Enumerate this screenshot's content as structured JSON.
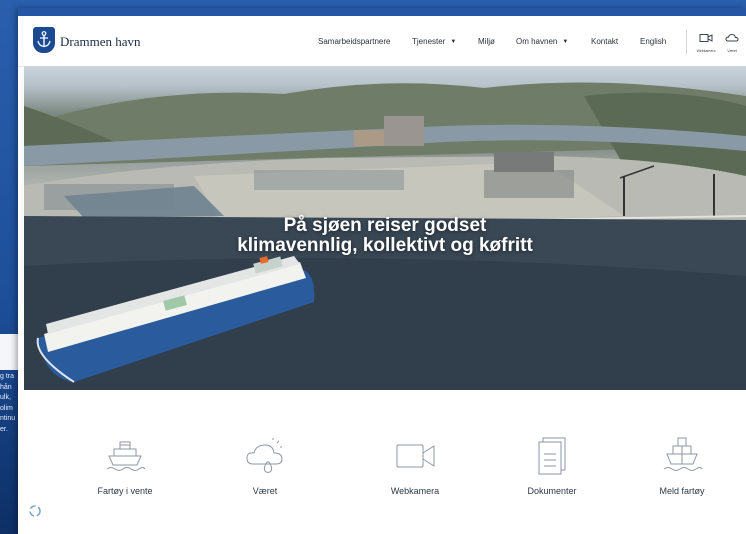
{
  "background_window": {
    "text_lines": [
      "g tra",
      "hån",
      "ulk,",
      "olim",
      "ntinu",
      "",
      "er."
    ]
  },
  "header": {
    "brand": "Drammen havn",
    "nav": [
      {
        "label": "Samarbeidspartnere",
        "dropdown": false
      },
      {
        "label": "Tjenester",
        "dropdown": true
      },
      {
        "label": "Miljø",
        "dropdown": false
      },
      {
        "label": "Om havnen",
        "dropdown": true
      },
      {
        "label": "Kontakt",
        "dropdown": false
      },
      {
        "label": "English",
        "dropdown": false
      }
    ],
    "icon_buttons": [
      {
        "icon": "webcam-icon",
        "label": "Webkamera"
      },
      {
        "icon": "weather-icon",
        "label": "Været"
      }
    ]
  },
  "hero": {
    "title_line1": "På sjøen reiser godset",
    "title_line2": "klimavennlig, kollektivt og køfritt"
  },
  "quick_links": [
    {
      "icon": "ship-waiting-icon",
      "label": "Fartøy i vente"
    },
    {
      "icon": "weather-icon",
      "label": "Været"
    },
    {
      "icon": "webcam-icon",
      "label": "Webkamera"
    },
    {
      "icon": "documents-icon",
      "label": "Dokumenter"
    },
    {
      "icon": "report-vessel-icon",
      "label": "Meld fartøy"
    }
  ],
  "colors": {
    "accent": "#2456a5",
    "brand_navy": "#1a4a92",
    "hero_text": "#ffffff",
    "icon_stroke": "#8e97a3"
  }
}
